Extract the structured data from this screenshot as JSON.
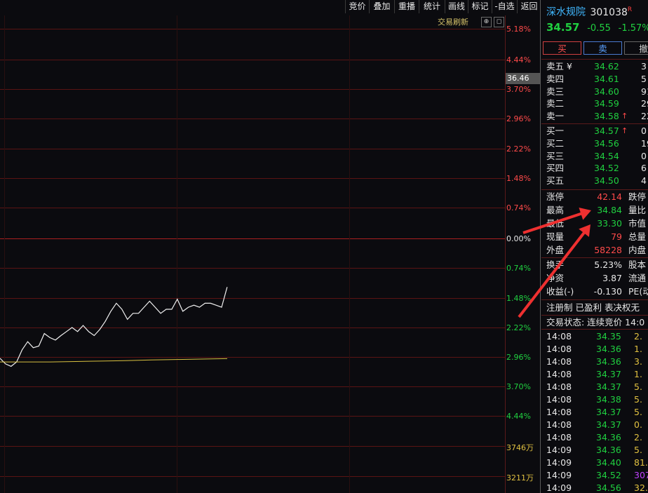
{
  "toolbar": [
    "竞价",
    "叠加",
    "重播",
    "统计",
    "画线",
    "标记",
    "-自选",
    "返回"
  ],
  "refresh_label": "交易刷新",
  "refresh_btn": "⊕",
  "close_btn": "◻",
  "axis_labels": [
    {
      "text": "5.18%",
      "color": "red"
    },
    {
      "text": "4.44%",
      "color": "red"
    },
    {
      "text": "3.70%",
      "color": "red"
    },
    {
      "text": "2.96%",
      "color": "red"
    },
    {
      "text": "2.22%",
      "color": "red"
    },
    {
      "text": "1.48%",
      "color": "red"
    },
    {
      "text": "0.74%",
      "color": "red"
    },
    {
      "text": "0.00%",
      "color": "white"
    },
    {
      "text": "0.74%",
      "color": "green"
    },
    {
      "text": "1.48%",
      "color": "green"
    },
    {
      "text": "2.22%",
      "color": "green"
    },
    {
      "text": "2.96%",
      "color": "green"
    },
    {
      "text": "3.70%",
      "color": "green"
    },
    {
      "text": "4.44%",
      "color": "green"
    },
    {
      "text": "3746万",
      "color": "yellow"
    },
    {
      "text": "3211万",
      "color": "yellow"
    }
  ],
  "cursor_price": "36.46",
  "chart_data": {
    "type": "line",
    "series": [
      {
        "values": [
          -2.96,
          -3.1,
          -3.16,
          -3.05,
          -2.75,
          -2.55,
          -2.7,
          -2.66,
          -2.35,
          -2.45,
          -2.51,
          -2.4,
          -2.3,
          -2.2,
          -2.3,
          -2.15,
          -2.3,
          -2.4,
          -2.25,
          -2.05,
          -1.8,
          -1.6,
          -1.75,
          -2.0,
          -1.85,
          -1.85,
          -1.7,
          -1.55,
          -1.7,
          -1.85,
          -1.75,
          -1.75,
          -1.5,
          -1.8,
          -1.7,
          -1.65,
          -1.7,
          -1.6,
          -1.6,
          -1.65,
          -1.7,
          -1.2
        ]
      },
      {
        "values": [
          -3.05,
          -3.05,
          -3.05,
          -3.04,
          -3.03,
          -3.02,
          -3.0,
          -2.99,
          -2.98,
          -2.97
        ]
      }
    ],
    "ylim": [
      -5.18,
      5.18
    ]
  },
  "stock": {
    "name": "深水规院",
    "code": "301038",
    "flag": "R",
    "price": "34.57",
    "change": "-0.55",
    "pct": "-1.57%"
  },
  "trade_buttons": [
    "买",
    "卖",
    "撤"
  ],
  "asks": [
    {
      "label": "卖五 ¥",
      "price": "34.62",
      "vol": "3",
      "arrow": ""
    },
    {
      "label": "卖四",
      "price": "34.61",
      "vol": "5",
      "arrow": ""
    },
    {
      "label": "卖三",
      "price": "34.60",
      "vol": "91",
      "arrow": ""
    },
    {
      "label": "卖二",
      "price": "34.59",
      "vol": "29",
      "arrow": ""
    },
    {
      "label": "卖一",
      "price": "34.58",
      "vol": "22",
      "arrow": "↑"
    }
  ],
  "bids": [
    {
      "label": "买一",
      "price": "34.57",
      "vol": "0",
      "arrow": "↑"
    },
    {
      "label": "买二",
      "price": "34.56",
      "vol": "19",
      "arrow": ""
    },
    {
      "label": "买三",
      "price": "34.54",
      "vol": "0",
      "arrow": ""
    },
    {
      "label": "买四",
      "price": "34.52",
      "vol": "6",
      "arrow": ""
    },
    {
      "label": "买五",
      "price": "34.50",
      "vol": "4",
      "arrow": ""
    }
  ],
  "stats1": [
    {
      "label": "涨停",
      "value": "42.14",
      "color": "red",
      "label2": "跌停"
    },
    {
      "label": "最高",
      "value": "34.84",
      "color": "green",
      "label2": "量比"
    },
    {
      "label": "最低",
      "value": "33.30",
      "color": "green",
      "label2": "市值"
    },
    {
      "label": "现量",
      "value": "79",
      "color": "red",
      "label2": "总量"
    },
    {
      "label": "外盘",
      "value": "58228",
      "color": "red",
      "label2": "内盘"
    }
  ],
  "stats2": [
    {
      "label": "换手",
      "value": "5.23%",
      "label2": "股本"
    },
    {
      "label": "净资",
      "value": "3.87",
      "label2": "流通"
    },
    {
      "label": "收益(-)",
      "value": "-0.130",
      "label2": "PE(动"
    }
  ],
  "tags_line": "注册制 已盈利 表决权无",
  "status_line": "交易状态: 连续竞价 14:0",
  "ticks": [
    {
      "t": "14:08",
      "p": "34.35",
      "v": "2.",
      "c": "yellow"
    },
    {
      "t": "14:08",
      "p": "34.36",
      "v": "1.",
      "c": "yellow"
    },
    {
      "t": "14:08",
      "p": "34.36",
      "v": "3.",
      "c": "yellow"
    },
    {
      "t": "14:08",
      "p": "34.37",
      "v": "1.",
      "c": "yellow"
    },
    {
      "t": "14:08",
      "p": "34.37",
      "v": "5.",
      "c": "yellow"
    },
    {
      "t": "14:08",
      "p": "34.38",
      "v": "5.",
      "c": "yellow"
    },
    {
      "t": "14:08",
      "p": "34.37",
      "v": "5.",
      "c": "yellow"
    },
    {
      "t": "14:08",
      "p": "34.37",
      "v": "0.",
      "c": "yellow"
    },
    {
      "t": "14:08",
      "p": "34.36",
      "v": "2.",
      "c": "yellow"
    },
    {
      "t": "14:09",
      "p": "34.36",
      "v": "5.",
      "c": "yellow"
    },
    {
      "t": "14:09",
      "p": "34.40",
      "v": "81.",
      "c": "yellow"
    },
    {
      "t": "14:09",
      "p": "34.52",
      "v": "307.",
      "c": "purple"
    },
    {
      "t": "14:09",
      "p": "34.56",
      "v": "32.",
      "c": "yellow"
    }
  ]
}
